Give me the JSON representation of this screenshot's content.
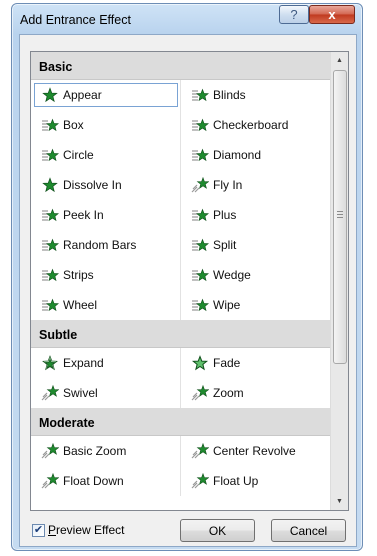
{
  "dialog": {
    "title": "Add Entrance Effect",
    "help_label": "?",
    "close_label": "x"
  },
  "groups": [
    {
      "name": "Basic",
      "effects": [
        {
          "label": "Appear",
          "icon": "star-solid",
          "selected": true
        },
        {
          "label": "Blinds",
          "icon": "star-blinds"
        },
        {
          "label": "Box",
          "icon": "star-blinds"
        },
        {
          "label": "Checkerboard",
          "icon": "star-blinds"
        },
        {
          "label": "Circle",
          "icon": "star-blinds"
        },
        {
          "label": "Diamond",
          "icon": "star-blinds"
        },
        {
          "label": "Dissolve In",
          "icon": "star-solid"
        },
        {
          "label": "Fly In",
          "icon": "star-motion"
        },
        {
          "label": "Peek In",
          "icon": "star-blinds"
        },
        {
          "label": "Plus",
          "icon": "star-blinds"
        },
        {
          "label": "Random Bars",
          "icon": "star-blinds"
        },
        {
          "label": "Split",
          "icon": "star-blinds"
        },
        {
          "label": "Strips",
          "icon": "star-blinds"
        },
        {
          "label": "Wedge",
          "icon": "star-blinds"
        },
        {
          "label": "Wheel",
          "icon": "star-blinds"
        },
        {
          "label": "Wipe",
          "icon": "star-blinds"
        }
      ]
    },
    {
      "name": "Subtle",
      "effects": [
        {
          "label": "Expand",
          "icon": "star-expand"
        },
        {
          "label": "Fade",
          "icon": "star-outline"
        },
        {
          "label": "Swivel",
          "icon": "star-motion"
        },
        {
          "label": "Zoom",
          "icon": "star-motion"
        }
      ]
    },
    {
      "name": "Moderate",
      "effects": [
        {
          "label": "Basic Zoom",
          "icon": "star-motion"
        },
        {
          "label": "Center Revolve",
          "icon": "star-motion"
        },
        {
          "label": "Float Down",
          "icon": "star-motion"
        },
        {
          "label": "Float Up",
          "icon": "star-motion"
        }
      ]
    }
  ],
  "footer": {
    "preview_label": "Preview Effect",
    "preview_checked": true,
    "ok_label": "OK",
    "cancel_label": "Cancel"
  },
  "colors": {
    "star_green": "#1e8a2e",
    "star_dark": "#0f4f1a",
    "stripe": "#9a9a9a"
  }
}
